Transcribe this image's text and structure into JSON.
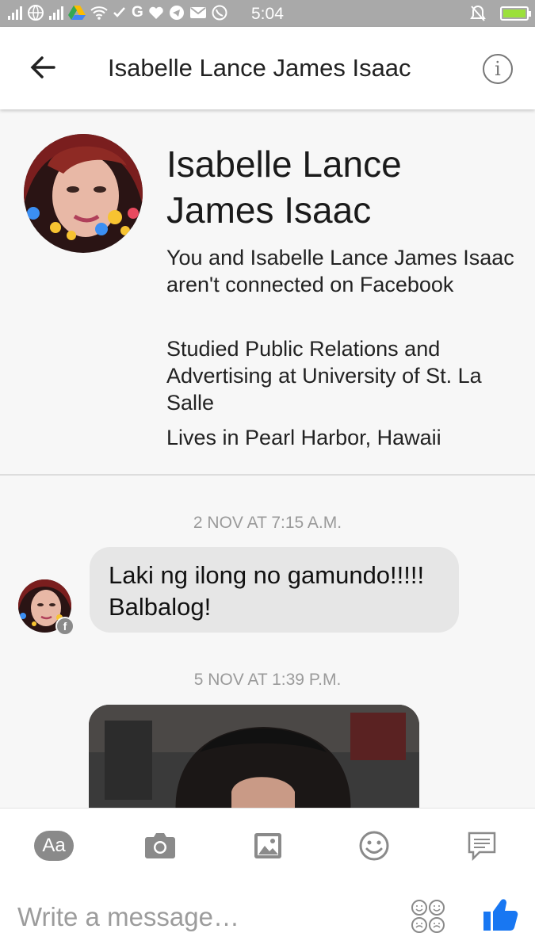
{
  "status_bar": {
    "time": "5:04"
  },
  "header": {
    "title": "Isabelle Lance James Isaac"
  },
  "profile": {
    "name": "Isabelle Lance James Isaac",
    "connection_note": "You and Isabelle Lance James Isaac aren't connected on Facebook",
    "education": "Studied Public Relations and Advertising at University of St. La Salle",
    "location": "Lives in Pearl Harbor, Hawaii"
  },
  "thread": {
    "timestamp_1": "2 NOV AT 7:15 A.M.",
    "message_1": "Laki ng ilong no gamundo!!!!! Balbalog!",
    "timestamp_2": "5 NOV AT 1:39 P.M."
  },
  "composer": {
    "placeholder": "Write a message…",
    "aa_label": "Aa"
  },
  "colors": {
    "accent": "#1877f2",
    "bubble": "#e6e6e6",
    "status_bar": "#a9a9a9"
  }
}
